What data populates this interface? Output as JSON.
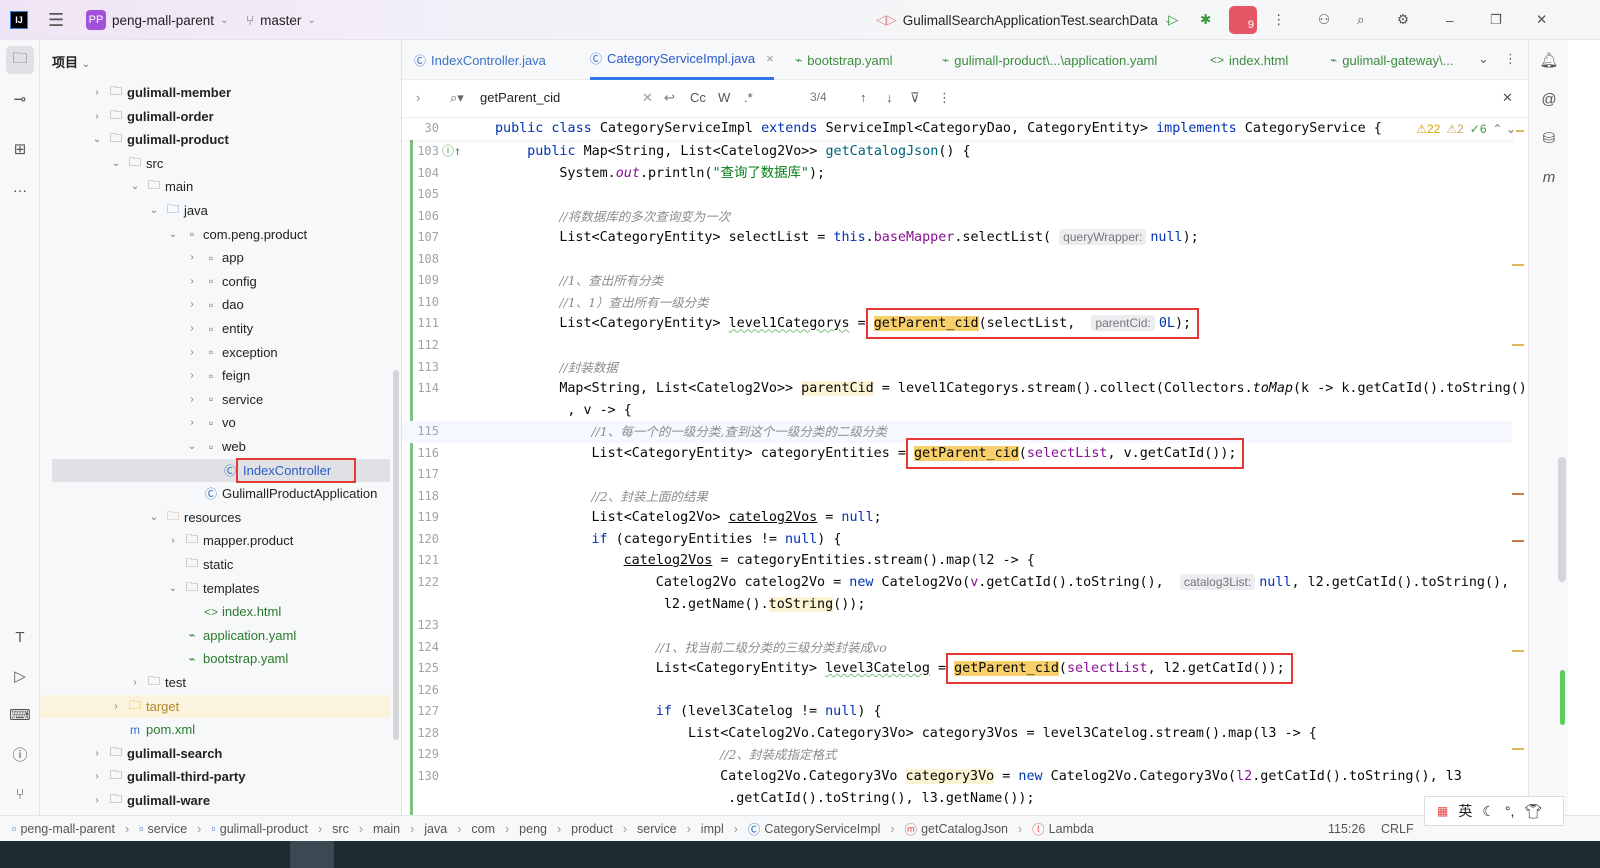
{
  "topbar": {
    "app_icon": "IJ",
    "project_badge": "PP",
    "project": "peng-mall-parent",
    "branch": "master",
    "run_config": "GulimallSearchApplicationTest.searchData",
    "notif_count": "9"
  },
  "project_panel": {
    "title": "项目",
    "items": [
      {
        "label": "gulimall-member",
        "level": 0,
        "icon": "module",
        "arrow": "›",
        "bold": true
      },
      {
        "label": "gulimall-order",
        "level": 0,
        "icon": "module",
        "arrow": "›",
        "bold": true
      },
      {
        "label": "gulimall-product",
        "level": 0,
        "icon": "module",
        "arrow": "⌄",
        "bold": true
      },
      {
        "label": "src",
        "level": 1,
        "icon": "folder",
        "arrow": "⌄"
      },
      {
        "label": "main",
        "level": 2,
        "icon": "folder",
        "arrow": "⌄"
      },
      {
        "label": "java",
        "level": 3,
        "icon": "folder-blue",
        "arrow": "⌄"
      },
      {
        "label": "com.peng.product",
        "level": 4,
        "icon": "package",
        "arrow": "⌄"
      },
      {
        "label": "app",
        "level": 5,
        "icon": "package",
        "arrow": "›"
      },
      {
        "label": "config",
        "level": 5,
        "icon": "package",
        "arrow": "›"
      },
      {
        "label": "dao",
        "level": 5,
        "icon": "package",
        "arrow": "›"
      },
      {
        "label": "entity",
        "level": 5,
        "icon": "package",
        "arrow": "›"
      },
      {
        "label": "exception",
        "level": 5,
        "icon": "package",
        "arrow": "›"
      },
      {
        "label": "feign",
        "level": 5,
        "icon": "package",
        "arrow": "›"
      },
      {
        "label": "service",
        "level": 5,
        "icon": "package",
        "arrow": "›"
      },
      {
        "label": "vo",
        "level": 5,
        "icon": "package",
        "arrow": "›"
      },
      {
        "label": "web",
        "level": 5,
        "icon": "package",
        "arrow": "⌄"
      },
      {
        "label": "IndexController",
        "level": 6,
        "icon": "class",
        "arrow": "",
        "selected": true,
        "boxed": true
      },
      {
        "label": "GulimallProductApplication",
        "level": 5,
        "icon": "spring-class",
        "arrow": ""
      },
      {
        "label": "resources",
        "level": 3,
        "icon": "folder-res",
        "arrow": "⌄"
      },
      {
        "label": "mapper.product",
        "level": 4,
        "icon": "folder",
        "arrow": "›"
      },
      {
        "label": "static",
        "level": 4,
        "icon": "folder",
        "arrow": ""
      },
      {
        "label": "templates",
        "level": 4,
        "icon": "folder",
        "arrow": "⌄"
      },
      {
        "label": "index.html",
        "level": 5,
        "icon": "html",
        "arrow": ""
      },
      {
        "label": "application.yaml",
        "level": 4,
        "icon": "yaml",
        "arrow": ""
      },
      {
        "label": "bootstrap.yaml",
        "level": 4,
        "icon": "yaml",
        "arrow": ""
      },
      {
        "label": "test",
        "level": 2,
        "icon": "folder",
        "arrow": "›"
      },
      {
        "label": "target",
        "level": 1,
        "icon": "folder-excluded",
        "arrow": "›",
        "excluded": true
      },
      {
        "label": "pom.xml",
        "level": 1,
        "icon": "maven",
        "arrow": ""
      },
      {
        "label": "gulimall-search",
        "level": 0,
        "icon": "module",
        "arrow": "›",
        "bold": true
      },
      {
        "label": "gulimall-third-party",
        "level": 0,
        "icon": "module",
        "arrow": "›",
        "bold": true
      },
      {
        "label": "gulimall-ware",
        "level": 0,
        "icon": "module",
        "arrow": "›",
        "bold": true
      }
    ]
  },
  "tabs": [
    {
      "label": "IndexController.java",
      "icon": "class",
      "color": "#3e8b3e"
    },
    {
      "label": "CategoryServiceImpl.java",
      "icon": "class",
      "active": true,
      "close": "×"
    },
    {
      "label": "bootstrap.yaml",
      "icon": "yaml"
    },
    {
      "label": "gulimall-product\\...\\application.yaml",
      "icon": "yaml"
    },
    {
      "label": "index.html",
      "icon": "html"
    },
    {
      "label": "gulimall-gateway\\...",
      "icon": "yaml"
    }
  ],
  "find": {
    "query": "getParent_cid",
    "match_case": "Cc",
    "words": "W",
    "regex": ".*",
    "count": "3/4"
  },
  "inspections": {
    "warnings": "22",
    "weak": "2",
    "ok": "6"
  },
  "code": {
    "sticky": {
      "n": "30",
      "ind": 0,
      "t": [
        [
          "k",
          "public class "
        ],
        [
          "",
          "CategoryServiceImpl "
        ],
        [
          "k",
          "extends "
        ],
        [
          "",
          "ServiceImpl<CategoryDao, CategoryEntity> "
        ],
        [
          "k",
          "implements "
        ],
        [
          "",
          "CategoryService {"
        ]
      ]
    },
    "lines": [
      {
        "n": "103",
        "ind": 4,
        "t": [
          [
            "k",
            "public "
          ],
          [
            "",
            "Map<String, List<Catelog2Vo>> "
          ],
          [
            "m",
            "getCatalogJson"
          ],
          [
            "",
            "() {"
          ]
        ]
      },
      {
        "n": "104",
        "ind": 8,
        "t": [
          [
            "",
            "System."
          ],
          [
            "fi",
            "out"
          ],
          [
            "",
            ".println("
          ],
          [
            "s",
            "\"查询了数据库\""
          ],
          [
            "",
            ");"
          ]
        ]
      },
      {
        "n": "105",
        "ind": 0,
        "t": []
      },
      {
        "n": "106",
        "ind": 8,
        "t": [
          [
            "c",
            "//将数据库的多次查询变为一次"
          ]
        ]
      },
      {
        "n": "107",
        "ind": 8,
        "t": [
          [
            "",
            "List<CategoryEntity> selectList = "
          ],
          [
            "k",
            "this"
          ],
          [
            "",
            "."
          ],
          [
            "f",
            "baseMapper"
          ],
          [
            "",
            ".selectList( "
          ],
          [
            "h",
            "queryWrapper:"
          ],
          [
            "k",
            "null"
          ],
          [
            "",
            ");"
          ]
        ]
      },
      {
        "n": "108",
        "ind": 0,
        "t": []
      },
      {
        "n": "109",
        "ind": 8,
        "t": [
          [
            "c",
            "//1、查出所有分类"
          ]
        ]
      },
      {
        "n": "110",
        "ind": 8,
        "t": [
          [
            "c",
            "//1、1）查出所有一级分类"
          ]
        ]
      },
      {
        "n": "111",
        "ind": 8,
        "t": [
          [
            "",
            "List<CategoryEntity> "
          ],
          [
            "w",
            "level1Categorys"
          ],
          [
            "",
            " = "
          ],
          [
            "box",
            [
              [
                "g",
                "getParent_cid"
              ],
              [
                "",
                "(selectList,  "
              ],
              [
                "h",
                "parentCid:"
              ],
              [
                "k",
                "0L"
              ],
              [
                "",
                ");"
              ]
            ]
          ]
        ]
      },
      {
        "n": "112",
        "ind": 0,
        "t": []
      },
      {
        "n": "113",
        "ind": 8,
        "t": [
          [
            "c",
            "//封装数据"
          ]
        ]
      },
      {
        "n": "114",
        "ind": 8,
        "t": [
          [
            "",
            "Map<String, List<Catelog2Vo>> "
          ],
          [
            "y",
            "parentCid"
          ],
          [
            "",
            " = level1Categorys.stream().collect(Collectors."
          ],
          [
            "i",
            "toMap"
          ],
          [
            "",
            "(k -> k.getCatId().toString()"
          ]
        ]
      },
      {
        "n": "",
        "ind": 8,
        "t": [
          [
            "",
            " , v -> {"
          ]
        ]
      },
      {
        "n": "115",
        "ind": 12,
        "cur": true,
        "t": [
          [
            "c",
            "//1、每一个的一级分类,查到这个一级分类的二级分类"
          ]
        ]
      },
      {
        "n": "116",
        "ind": 12,
        "t": [
          [
            "",
            "List<CategoryEntity> categoryEntities = "
          ],
          [
            "box",
            [
              [
                "g",
                "getParent_cid"
              ],
              [
                "",
                "("
              ],
              [
                "f",
                "selectList"
              ],
              [
                "",
                ", v.getCatId());"
              ]
            ]
          ]
        ]
      },
      {
        "n": "117",
        "ind": 0,
        "t": []
      },
      {
        "n": "118",
        "ind": 12,
        "t": [
          [
            "c",
            "//2、封装上面的结果"
          ]
        ]
      },
      {
        "n": "119",
        "ind": 12,
        "t": [
          [
            "",
            "List<Catelog2Vo> "
          ],
          [
            "u",
            "catelog2Vos"
          ],
          [
            "",
            " = "
          ],
          [
            "k",
            "null"
          ],
          [
            "",
            ";"
          ]
        ]
      },
      {
        "n": "120",
        "ind": 12,
        "t": [
          [
            "k",
            "if "
          ],
          [
            "",
            "(categoryEntities != "
          ],
          [
            "k",
            "null"
          ],
          [
            "",
            ") {"
          ]
        ]
      },
      {
        "n": "121",
        "ind": 16,
        "t": [
          [
            "u",
            "catelog2Vos"
          ],
          [
            "",
            " = categoryEntities.stream().map(l2 -> {"
          ]
        ]
      },
      {
        "n": "122",
        "ind": 20,
        "t": [
          [
            "",
            "Catelog2Vo catelog2Vo = "
          ],
          [
            "k",
            "new "
          ],
          [
            "",
            "Catelog2Vo("
          ],
          [
            "f",
            "v"
          ],
          [
            "",
            ".getCatId().toString(),  "
          ],
          [
            "h",
            "catalog3List:"
          ],
          [
            "k",
            "null"
          ],
          [
            "",
            ", l2.getCatId().toString(),"
          ]
        ]
      },
      {
        "n": "",
        "ind": 20,
        "t": [
          [
            "",
            " l2.getName()."
          ],
          [
            "y",
            "toString"
          ],
          [
            "",
            "());"
          ]
        ]
      },
      {
        "n": "123",
        "ind": 0,
        "t": []
      },
      {
        "n": "124",
        "ind": 20,
        "t": [
          [
            "c",
            "//1、找当前二级分类的三级分类封装成vo"
          ]
        ]
      },
      {
        "n": "125",
        "ind": 20,
        "t": [
          [
            "",
            "List<CategoryEntity> "
          ],
          [
            "w",
            "level3Catelog"
          ],
          [
            "",
            " = "
          ],
          [
            "box",
            [
              [
                "g",
                "getParent_cid"
              ],
              [
                "",
                "("
              ],
              [
                "f",
                "selectList"
              ],
              [
                "",
                ", l2.getCatId());"
              ]
            ]
          ]
        ]
      },
      {
        "n": "126",
        "ind": 0,
        "t": []
      },
      {
        "n": "127",
        "ind": 20,
        "t": [
          [
            "k",
            "if "
          ],
          [
            "",
            "(level3Catelog != "
          ],
          [
            "k",
            "null"
          ],
          [
            "",
            ") {"
          ]
        ]
      },
      {
        "n": "128",
        "ind": 24,
        "t": [
          [
            "",
            "List<Catelog2Vo.Category3Vo> category3Vos = level3Catelog.stream().map(l3 -> {"
          ]
        ]
      },
      {
        "n": "129",
        "ind": 28,
        "t": [
          [
            "c",
            "//2、封装成指定格式"
          ]
        ]
      },
      {
        "n": "130",
        "ind": 28,
        "t": [
          [
            "",
            "Catelog2Vo.Category3Vo "
          ],
          [
            "y",
            "category3Vo"
          ],
          [
            "",
            " = "
          ],
          [
            "k",
            "new "
          ],
          [
            "",
            "Catelog2Vo.Category3Vo("
          ],
          [
            "f",
            "l2"
          ],
          [
            "",
            ".getCatId().toString(), l3"
          ]
        ]
      },
      {
        "n": "",
        "ind": 28,
        "t": [
          [
            "",
            " .getCatId().toString(), l3.getName());"
          ]
        ]
      }
    ]
  },
  "status": {
    "breadcrumbs": [
      "peng-mall-parent",
      "service",
      "gulimall-product",
      "src",
      "main",
      "java",
      "com",
      "peng",
      "product",
      "service",
      "impl",
      "CategoryServiceImpl",
      "getCatalogJson",
      "Lambda"
    ],
    "position": "115:26",
    "line_sep": "CRLF"
  },
  "ime": {
    "lang": "英"
  },
  "colors": {
    "accent": "#3574f0",
    "search_match": "#f7cf6b",
    "red_box": "#e53935",
    "added_gutter": "#7ec27e"
  }
}
